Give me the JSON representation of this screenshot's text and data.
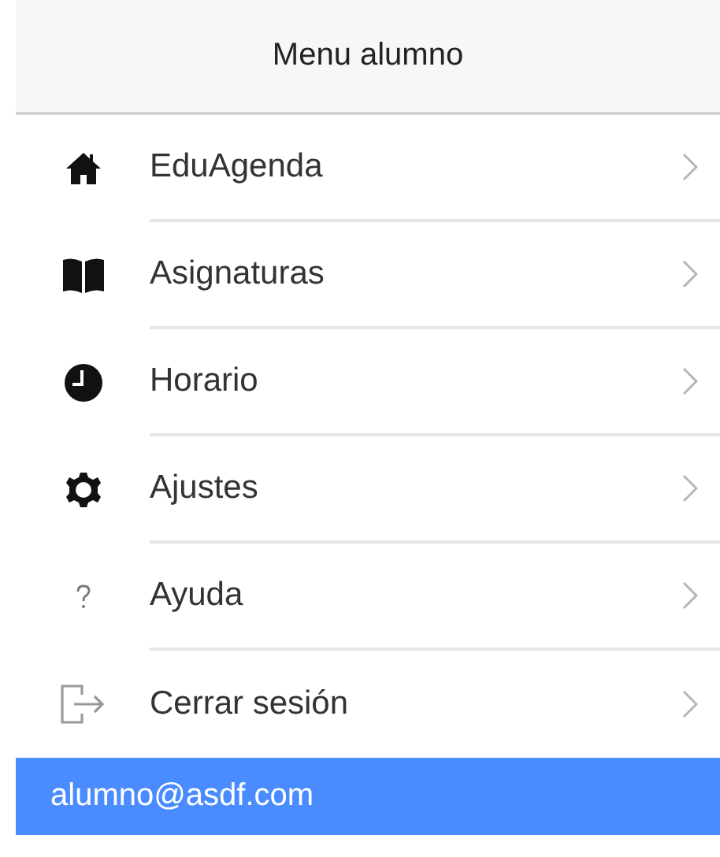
{
  "header": {
    "title": "Menu alumno"
  },
  "menu": [
    {
      "label": "EduAgenda"
    },
    {
      "label": "Asignaturas"
    },
    {
      "label": "Horario"
    },
    {
      "label": "Ajustes"
    },
    {
      "label": "Ayuda"
    },
    {
      "label": "Cerrar sesión"
    }
  ],
  "footer": {
    "email": "alumno@asdf.com"
  }
}
